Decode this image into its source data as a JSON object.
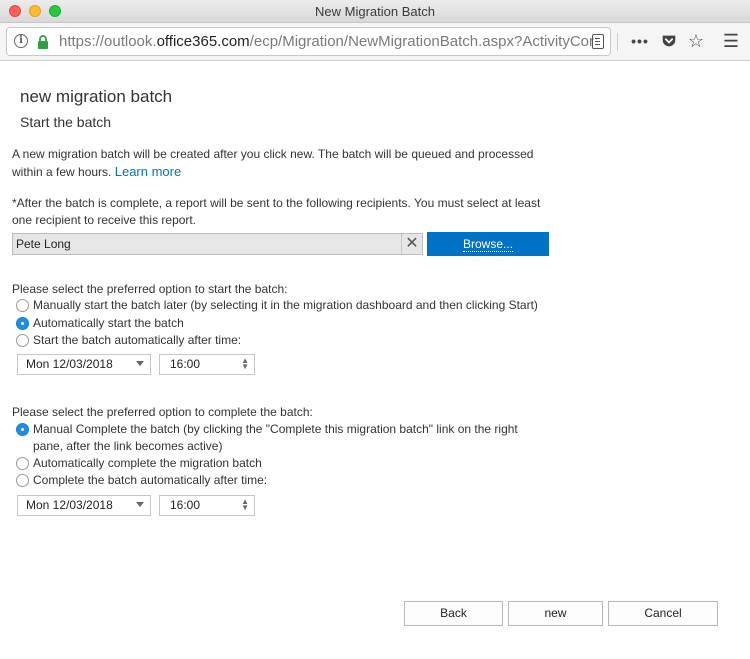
{
  "window": {
    "title": "New Migration Batch"
  },
  "browser": {
    "url_prefix": "https://outlook.",
    "url_host": "office365.com",
    "url_path": "/ecp/Migration/NewMigrationBatch.aspx?ActivityCor"
  },
  "page": {
    "title": "new migration batch",
    "step_title": "Start the batch",
    "intro_text": "A new migration batch will be created after you click new. The batch will be queued and processed within a few hours.",
    "learn_more": "Learn more",
    "report_text": "*After the batch is complete, a report will be sent to the following recipients. You must select at least one recipient to receive this report.",
    "recipient": "Pete Long",
    "browse_label": "Browse...",
    "start_section": {
      "label": "Please select the preferred option to start the batch:",
      "options": [
        {
          "label": "Manually start the batch later (by selecting it in the migration dashboard and then clicking Start)",
          "checked": false
        },
        {
          "label": "Automatically start the batch",
          "checked": true
        },
        {
          "label": "Start the batch automatically after time:",
          "checked": false
        }
      ],
      "date": "Mon 12/03/2018",
      "time": "16:00"
    },
    "complete_section": {
      "label": "Please select the preferred option to complete the batch:",
      "options": [
        {
          "label": "Manual Complete the batch (by clicking the \"Complete this migration batch\" link on the right pane, after the link becomes active)",
          "checked": true
        },
        {
          "label": "Automatically complete the migration batch",
          "checked": false
        },
        {
          "label": "Complete the batch automatically after time:",
          "checked": false
        }
      ],
      "date": "Mon 12/03/2018",
      "time": "16:00"
    },
    "buttons": {
      "back": "Back",
      "new": "new",
      "cancel": "Cancel"
    }
  }
}
